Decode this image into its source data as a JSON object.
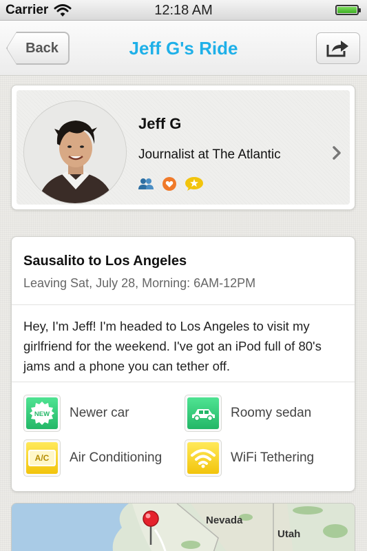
{
  "status_bar": {
    "carrier": "Carrier",
    "time": "12:18 AM"
  },
  "nav": {
    "back_label": "Back",
    "title": "Jeff G's Ride",
    "title_color": "#1fb0e8",
    "share_icon": "share-arrow-icon"
  },
  "profile": {
    "name": "Jeff G",
    "job": "Journalist at The Atlantic",
    "badges": [
      "friends-icon",
      "heart-icon",
      "star-chat-icon"
    ]
  },
  "ride": {
    "route": "Sausalito to Los Angeles",
    "schedule": "Leaving Sat, July 28, Morning: 6AM-12PM",
    "description": "Hey, I'm Jeff! I'm headed to Los Angeles to visit my girlfriend for the weekend. I've got an iPod full of 80's jams and a phone you can tether off.",
    "features": [
      {
        "label": "Newer car",
        "icon": "new-badge-icon",
        "color": "green"
      },
      {
        "label": "Roomy sedan",
        "icon": "sedan-car-icon",
        "color": "green"
      },
      {
        "label": "Air Conditioning",
        "icon": "ac-icon",
        "color": "yellow",
        "icon_text": "A/C"
      },
      {
        "label": "WiFi Tethering",
        "icon": "wifi-icon",
        "color": "yellow"
      }
    ],
    "new_badge_text": "NEW"
  },
  "map": {
    "labels": [
      "Nevada",
      "Utah"
    ]
  }
}
